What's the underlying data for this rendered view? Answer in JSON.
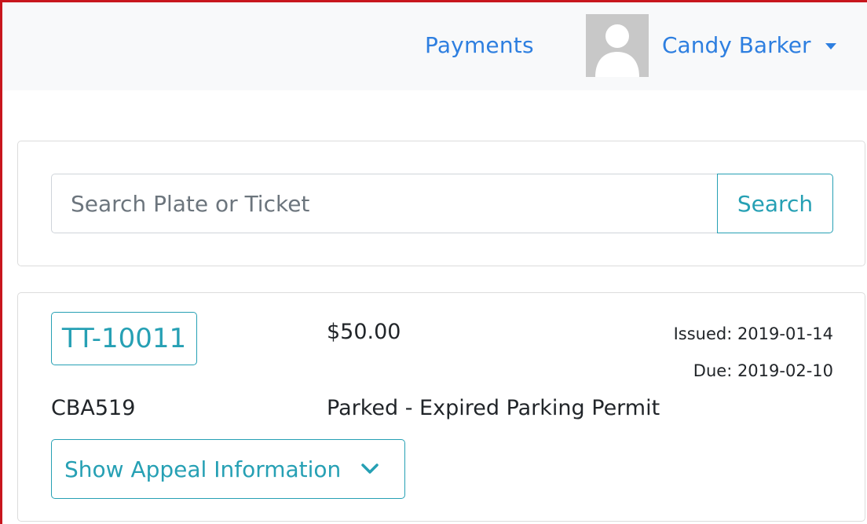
{
  "navbar": {
    "payments_label": "Payments",
    "user_name": "Candy Barker"
  },
  "search": {
    "placeholder": "Search Plate or Ticket",
    "value": "",
    "button_label": "Search"
  },
  "ticket": {
    "id": "TT-10011",
    "amount": "$50.00",
    "issued": "Issued: 2019-01-14",
    "due": "Due: 2019-02-10",
    "plate": "CBA519",
    "violation": "Parked - Expired Parking Permit",
    "appeal_button_label": "Show Appeal Information"
  },
  "colors": {
    "accent": "#26a0b4",
    "link": "#2e7fe0",
    "frame_border": "#c8161d",
    "navbar_bg": "#f8f9fa"
  },
  "icons": {
    "avatar": "user-silhouette-icon",
    "user_menu": "caret-down-icon",
    "appeal_toggle": "chevron-down-icon"
  }
}
